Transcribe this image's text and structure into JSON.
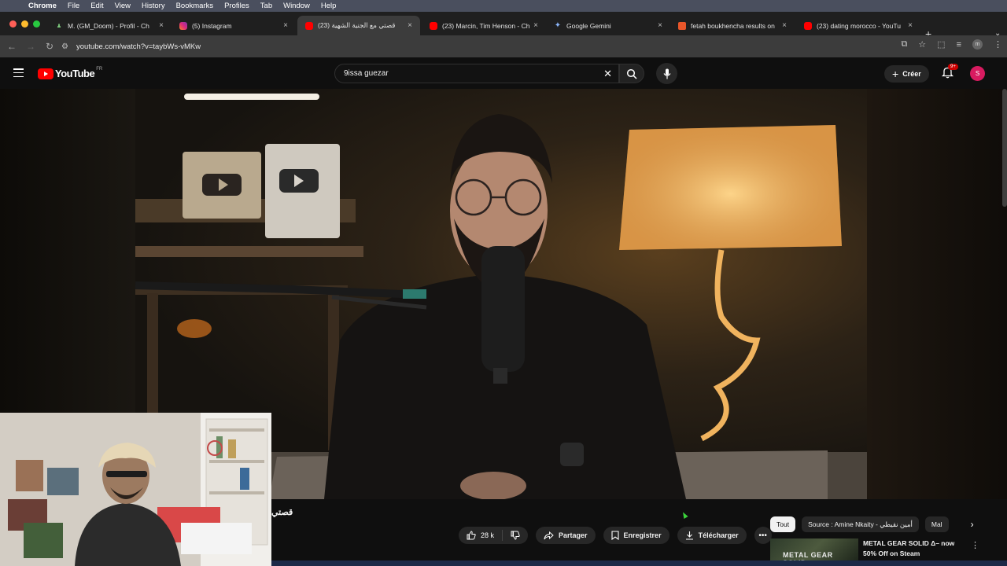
{
  "mac_menu": {
    "app": "Chrome",
    "items": [
      "File",
      "Edit",
      "View",
      "History",
      "Bookmarks",
      "Profiles",
      "Tab",
      "Window",
      "Help"
    ]
  },
  "tabs": [
    {
      "title": "M. (GM_Doom) - Profil - Ch",
      "favicon": "person-icon",
      "active": false
    },
    {
      "title": "(5) Instagram",
      "favicon": "instagram-icon",
      "active": false
    },
    {
      "title": "(23) قصتي مع الجنية الشهية",
      "favicon": "youtube-icon",
      "active": true
    },
    {
      "title": "(23) Marcin, Tim Henson - Ch",
      "favicon": "youtube-icon",
      "active": false
    },
    {
      "title": "Google Gemini",
      "favicon": "gemini-icon",
      "active": false
    },
    {
      "title": "fetah boukhencha results on",
      "favicon": "search-icon",
      "active": false
    },
    {
      "title": "(23) dating morocco - YouTu",
      "favicon": "youtube-icon",
      "active": false
    }
  ],
  "address": {
    "url": "youtube.com/watch?v=taybWs-vMKw"
  },
  "youtube": {
    "logo_text": "YouTube",
    "country": "FR",
    "search_value": "9issa guezar",
    "create_label": "Créer",
    "notif_badge": "9+",
    "avatar_letter": "S"
  },
  "video": {
    "title": "قصتي"
  },
  "actions": {
    "like_count": "28 k",
    "share": "Partager",
    "save": "Enregistrer",
    "download": "Télécharger"
  },
  "chips": [
    "Tout",
    "Source : Amine Nkaity - أمين نقيطي",
    "Mal"
  ],
  "ad": {
    "thumb_text": "METAL GEAR SOLID",
    "line1": "METAL GEAR SOLID Δ– now",
    "line2": "50% Off on Steam"
  },
  "colors": {
    "yt_red": "#ff0000",
    "background": "#0f0f0f",
    "chip_active": "#f1f1f1",
    "avatar": "#d81b60"
  }
}
